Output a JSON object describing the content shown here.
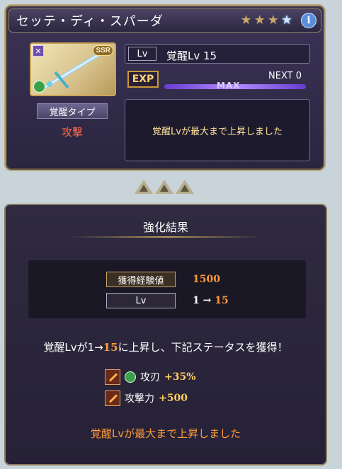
{
  "header": {
    "weapon_name": "セッテ・ディ・スパーダ",
    "stars": [
      "gold",
      "gold",
      "gold",
      "blue"
    ],
    "info_glyph": "i"
  },
  "weapon_card": {
    "rarity": "SSR",
    "element_glyph": "✕"
  },
  "awaken": {
    "type_label": "覚醒タイプ",
    "type_value": "攻撃"
  },
  "level": {
    "tag": "Lv",
    "value": "覚醒Lv 15"
  },
  "exp": {
    "tag": "EXP",
    "next": "NEXT 0",
    "max_label": "MAX",
    "fill_fraction": 1.0
  },
  "message": "覚醒Lvが最大まで上昇しました",
  "result": {
    "title": "強化結果",
    "exp_tag": "獲得経験値",
    "exp_value": "1500",
    "lv_tag": "Lv",
    "lv_from": "1",
    "lv_arrow": "→",
    "lv_to": "15",
    "summary_prefix": "覚醒Lvが1→",
    "summary_highlight": "15",
    "summary_suffix": "に上昇し、下記ステータスを獲得！",
    "bonuses": [
      {
        "name": "攻刃",
        "value": "+35%"
      },
      {
        "name": "攻撃力",
        "value": "+500"
      }
    ],
    "footer": "覚醒Lvが最大まで上昇しました"
  }
}
